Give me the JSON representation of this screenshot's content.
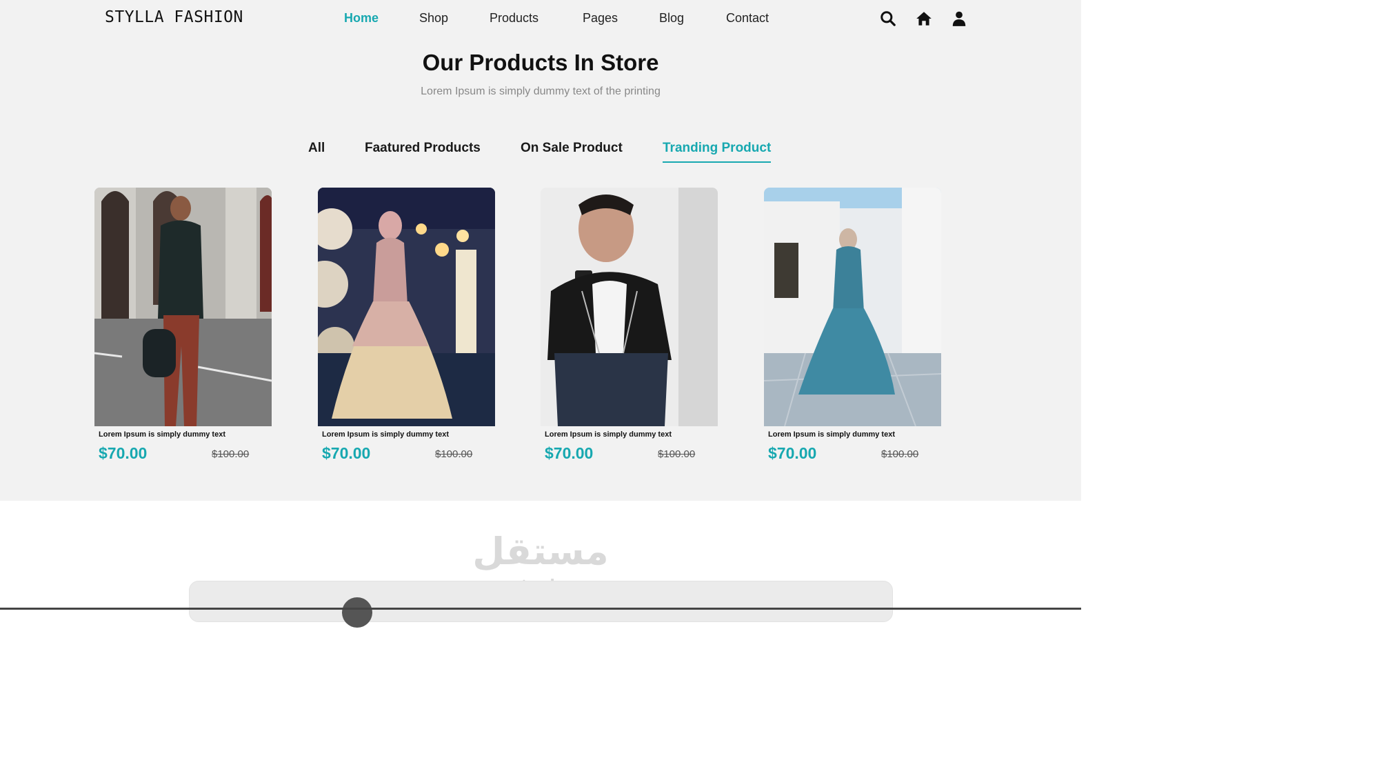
{
  "header": {
    "logo": "STYLLA FASHION",
    "nav": [
      {
        "label": "Home",
        "active": true
      },
      {
        "label": "Shop",
        "active": false
      },
      {
        "label": "Products",
        "active": false
      },
      {
        "label": "Pages",
        "active": false
      },
      {
        "label": "Blog",
        "active": false
      },
      {
        "label": "Contact",
        "active": false
      }
    ],
    "icons": [
      "search-icon",
      "home-icon",
      "user-icon"
    ]
  },
  "section": {
    "title": "Our Products In Store",
    "subtitle": "Lorem Ipsum is simply dummy text of the printing"
  },
  "filters": [
    {
      "label": "All",
      "active": false
    },
    {
      "label": "Faatured Products",
      "active": false
    },
    {
      "label": "On Sale Product",
      "active": false
    },
    {
      "label": "Tranding Product",
      "active": true
    }
  ],
  "products": [
    {
      "name": "Lorem Ipsum is simply dummy text",
      "price": "$70.00",
      "old_price": "$100.00"
    },
    {
      "name": "Lorem Ipsum is simply dummy text",
      "price": "$70.00",
      "old_price": "$100.00"
    },
    {
      "name": "Lorem Ipsum is simply dummy text",
      "price": "$70.00",
      "old_price": "$100.00"
    },
    {
      "name": "Lorem Ipsum is simply dummy text",
      "price": "$70.00",
      "old_price": "$100.00"
    }
  ],
  "watermark": {
    "arabic": "مستقل",
    "latin": "mostaql.com"
  },
  "colors": {
    "accent": "#17a8b0",
    "background": "#f2f2f2"
  }
}
